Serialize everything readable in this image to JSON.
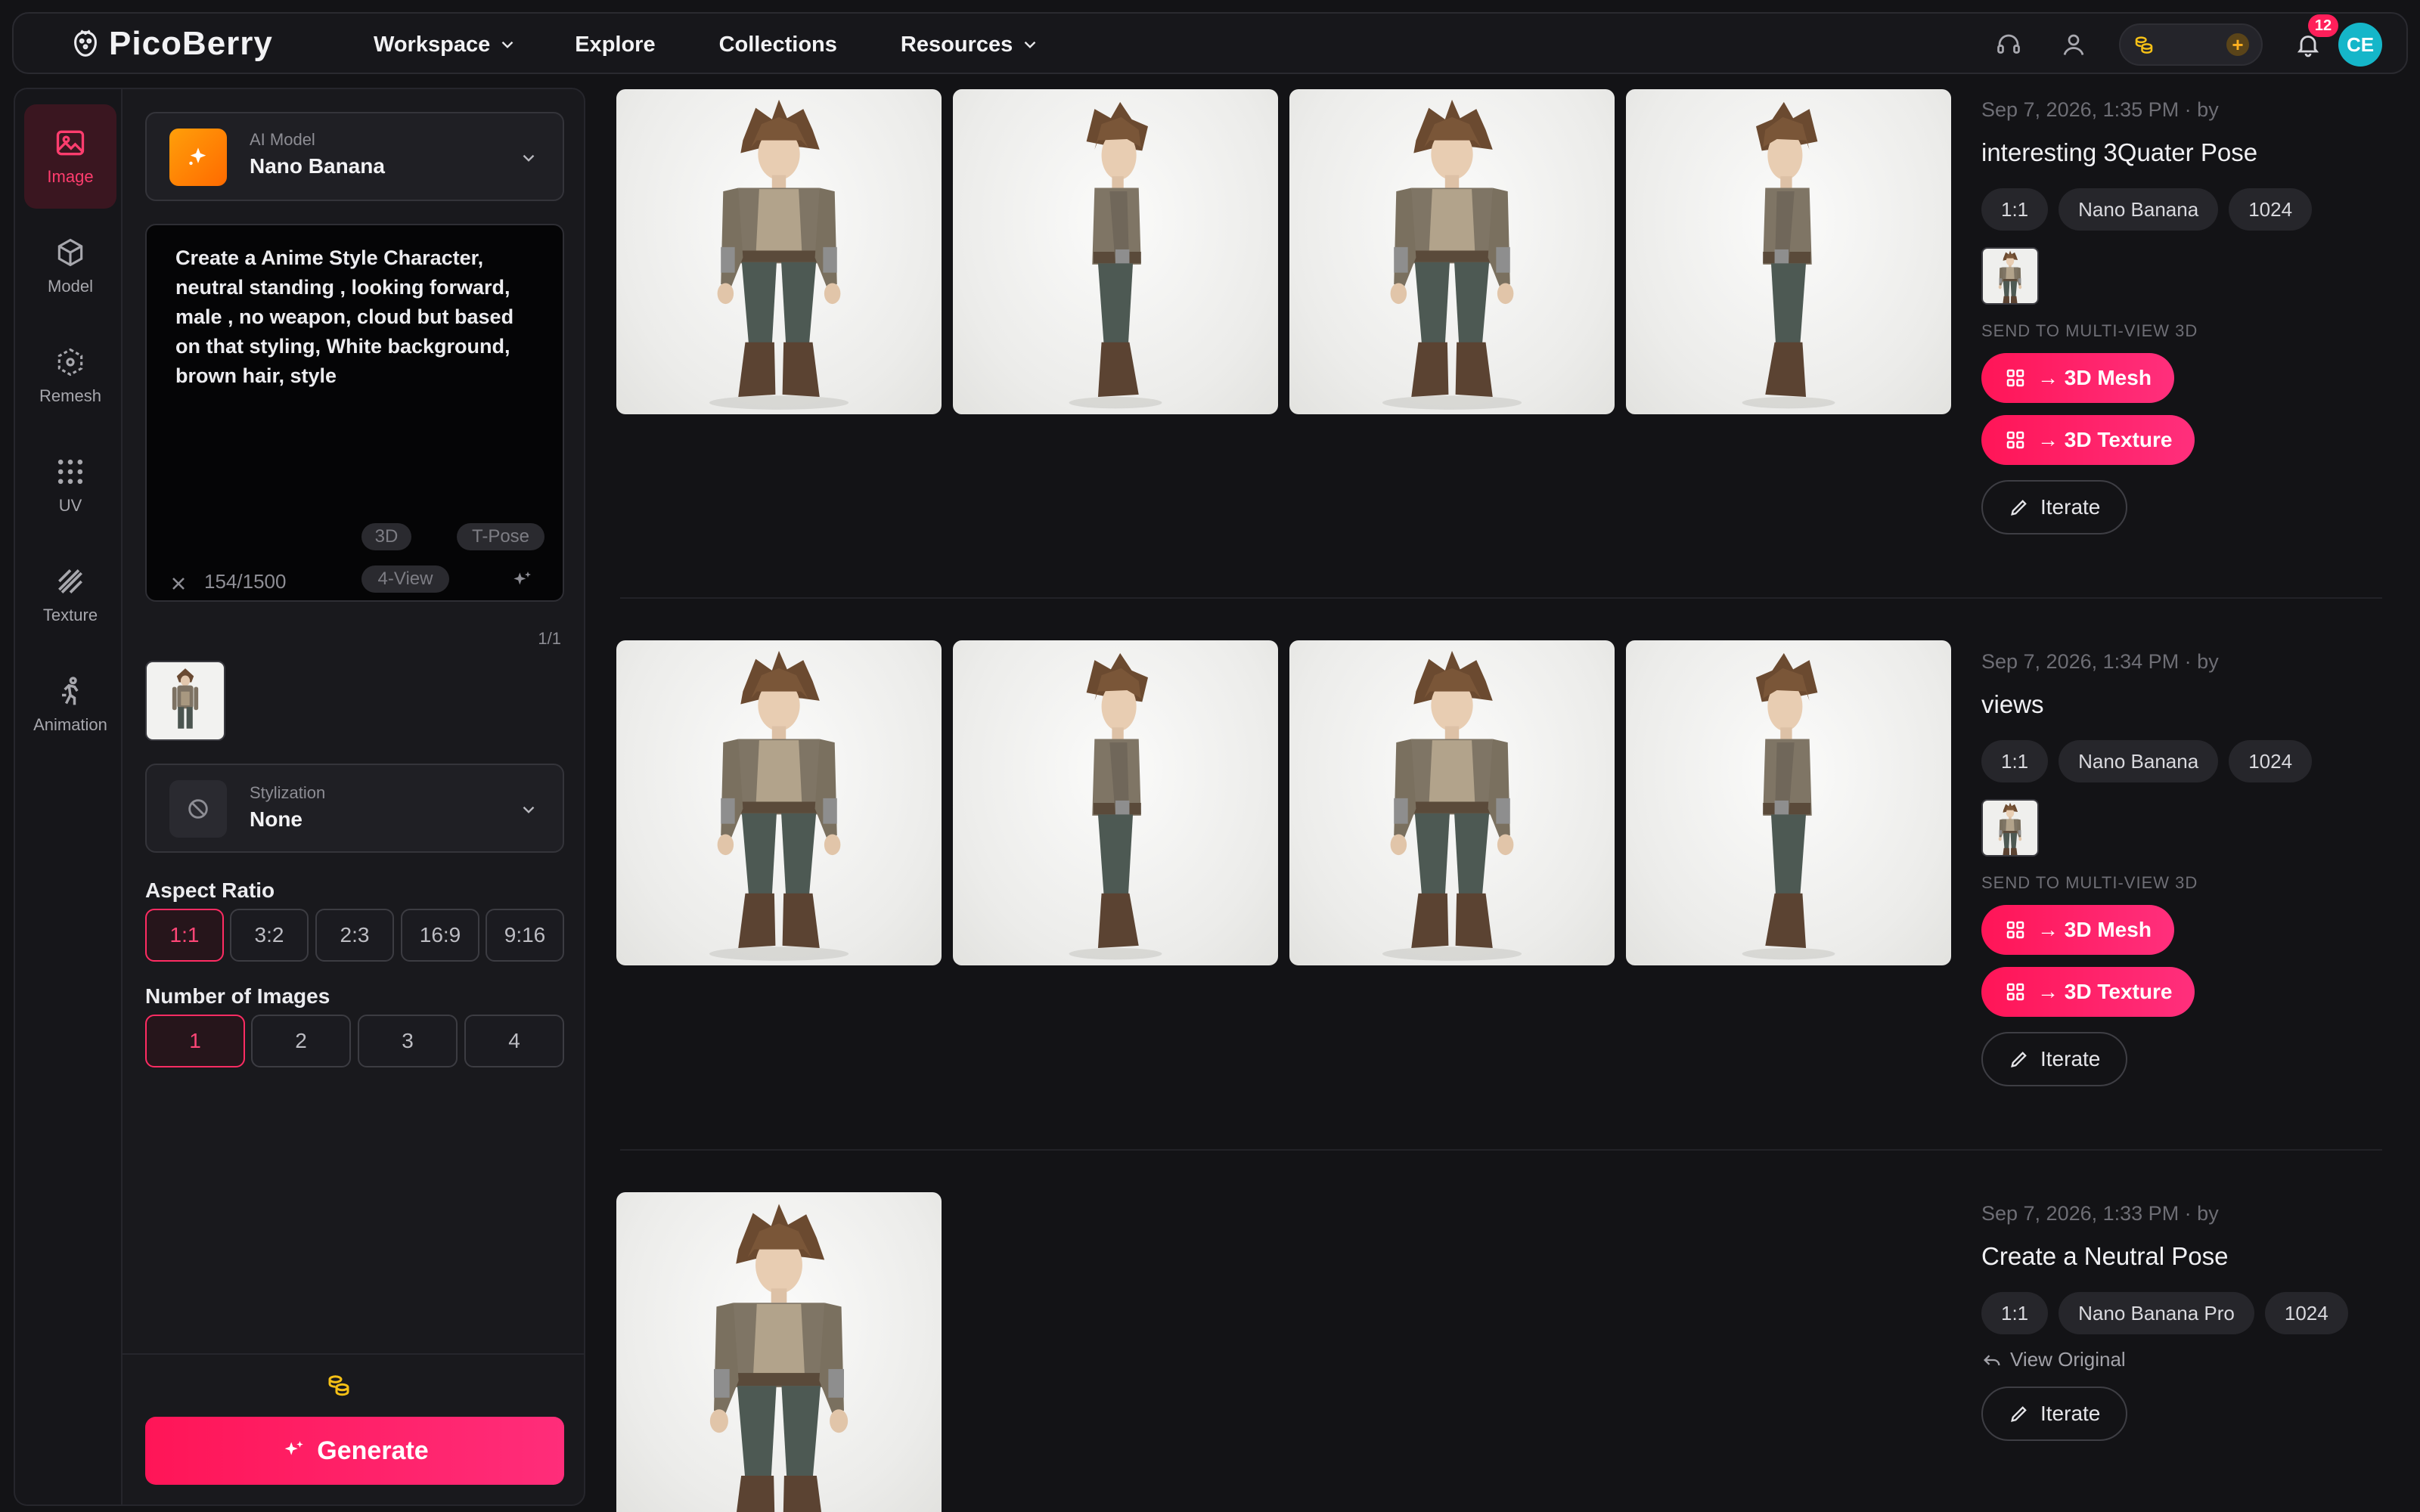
{
  "app": {
    "name": "PicoBerry"
  },
  "nav": [
    {
      "label": "Workspace",
      "has_dropdown": true
    },
    {
      "label": "Explore",
      "has_dropdown": false
    },
    {
      "label": "Collections",
      "has_dropdown": false
    },
    {
      "label": "Resources",
      "has_dropdown": true
    }
  ],
  "header": {
    "notifications_count": "12",
    "avatar_initials": "CE",
    "credits_plus": "+"
  },
  "rail": [
    {
      "label": "Image",
      "icon": "image-icon",
      "active": true
    },
    {
      "label": "Model",
      "icon": "cube-icon",
      "active": false
    },
    {
      "label": "Remesh",
      "icon": "remesh-icon",
      "active": false
    },
    {
      "label": "UV",
      "icon": "grid-icon",
      "active": false
    },
    {
      "label": "Texture",
      "icon": "texture-icon",
      "active": false
    },
    {
      "label": "Animation",
      "icon": "running-icon",
      "active": false
    }
  ],
  "panel": {
    "model": {
      "label": "AI Model",
      "value": "Nano Banana"
    },
    "prompt": {
      "text": "Create a Anime Style Character,\nneutral standing , looking forward,\nmale , no weapon, cloud but based\non that styling, White background,\nbrown hair, style",
      "counter": "154/1500",
      "chips": [
        "3D",
        "T-Pose",
        "4-View"
      ]
    },
    "page_indicator": "1/1",
    "stylization": {
      "label": "Stylization",
      "value": "None"
    },
    "aspect_ratio": {
      "title": "Aspect Ratio",
      "options": [
        "1:1",
        "3:2",
        "2:3",
        "16:9",
        "9:16"
      ],
      "selected": "1:1"
    },
    "num_images": {
      "title": "Number of Images",
      "options": [
        "1",
        "2",
        "3",
        "4"
      ],
      "selected": "1"
    },
    "generate_label": "Generate"
  },
  "results": [
    {
      "date": "Sep 7, 2026, 1:35 PM  · by",
      "title": "interesting 3Quater Pose",
      "tags": [
        "1:1",
        "Nano Banana",
        "1024"
      ],
      "views": [
        "front",
        "side",
        "back",
        "side-r"
      ],
      "send_label": "SEND TO MULTI-VIEW 3D",
      "mesh_label": "→ 3D Mesh",
      "texture_label": "→ 3D Texture",
      "iterate_label": "Iterate"
    },
    {
      "date": "Sep 7, 2026, 1:34 PM  · by",
      "title": "views",
      "tags": [
        "1:1",
        "Nano Banana",
        "1024"
      ],
      "views": [
        "front",
        "side",
        "back",
        "side-r"
      ],
      "send_label": "SEND TO MULTI-VIEW 3D",
      "mesh_label": "→ 3D Mesh",
      "texture_label": "→ 3D Texture",
      "iterate_label": "Iterate"
    },
    {
      "date": "Sep 7, 2026, 1:33 PM  · by",
      "title": "Create a Neutral Pose",
      "tags": [
        "1:1",
        "Nano Banana Pro",
        "1024"
      ],
      "views": [
        "front"
      ],
      "view_original_label": "View Original",
      "iterate_label": "Iterate"
    }
  ],
  "colors": {
    "accent": "#ff1f5a",
    "background": "#131316",
    "avatar": "#15b6c9",
    "model_icon": "#ff8a00"
  }
}
